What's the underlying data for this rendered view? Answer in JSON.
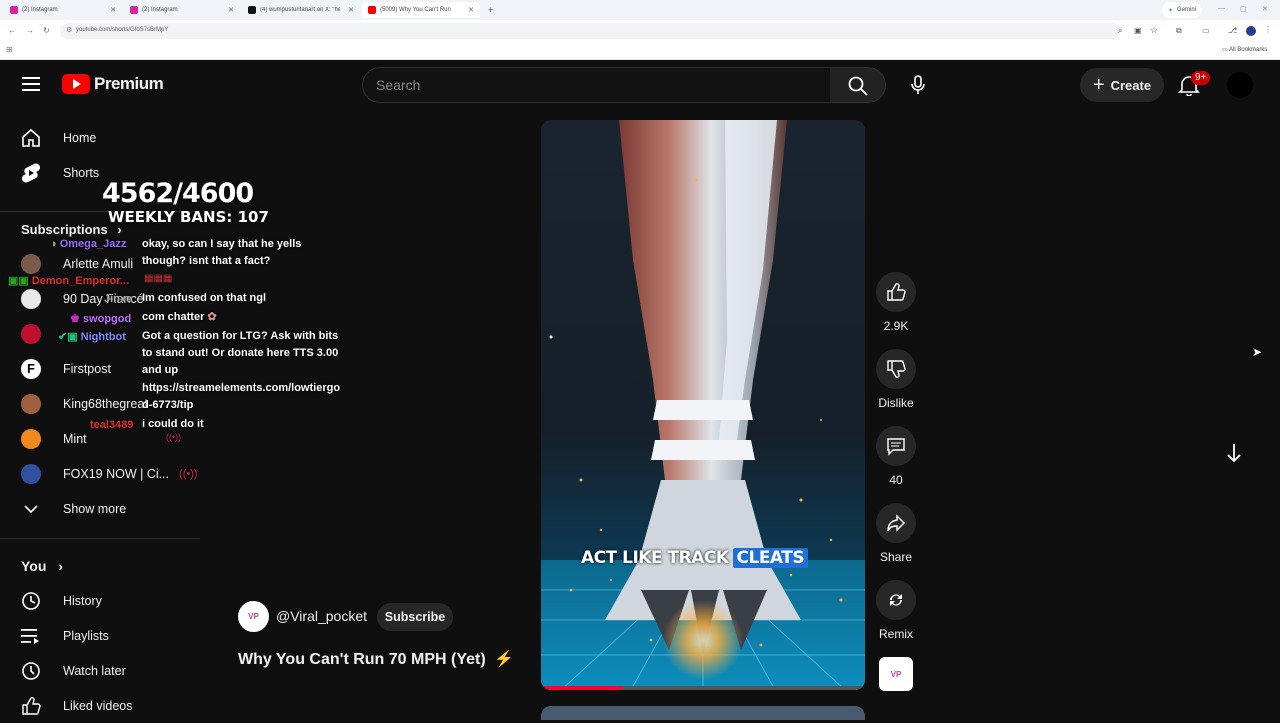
{
  "browser": {
    "tabs": [
      {
        "title": "(2) Instagram"
      },
      {
        "title": "(2) Instagram"
      },
      {
        "title": "(4) wumpusfunfanart on X: \"he..."
      },
      {
        "title": "(5009) Why You Can't Run"
      }
    ],
    "new_tab": "+",
    "gemini": "Gemini",
    "url": "youtube.com/shorts/GfoS7sBrMpY",
    "all_bookmarks": "All Bookmarks"
  },
  "header": {
    "logo_text": "Premium",
    "search_placeholder": "Search",
    "create_label": "Create",
    "notif_badge": "9+"
  },
  "sidebar": {
    "items": [
      {
        "label": "Home"
      },
      {
        "label": "Shorts"
      }
    ],
    "subscriptions_title": "Subscriptions",
    "subscriptions": [
      {
        "label": "Arlette Amuli",
        "color": "#7a5a4a"
      },
      {
        "label": "90 Day Fiancé",
        "color": "#e8e8e8"
      },
      {
        "label": "",
        "color": "#c01030"
      },
      {
        "label": "Firstpost",
        "color": "#ffffff"
      },
      {
        "label": "King68thegreat",
        "color": "#a06040"
      },
      {
        "label": "Mint",
        "color": "#f08a1c"
      },
      {
        "label": "FOX19 NOW | Ci...",
        "color": "#3050a0"
      }
    ],
    "show_more": "Show more",
    "you_title": "You",
    "you_items": [
      {
        "label": "History"
      },
      {
        "label": "Playlists"
      },
      {
        "label": "Watch later"
      },
      {
        "label": "Liked videos"
      }
    ]
  },
  "overlay": {
    "ban_count": "4562/4600",
    "weekly_bans": "WEEKLY BANS: 107",
    "users": [
      {
        "name": "Omega_Jazz",
        "color": "#9b6bff"
      },
      {
        "name": "Demon_Emperor...",
        "color": "#e0302a"
      },
      {
        "name": "Jinxe",
        "color": "#b0b0b0"
      },
      {
        "name": "swopgod",
        "color": "#c070ff"
      },
      {
        "name": "Nightbot",
        "color": "#7b8cff"
      },
      {
        "name": "teal3489",
        "color": "#e0302a"
      }
    ],
    "messages": [
      "okay, so can I say that he yells",
      "though? isnt that a fact?",
      "Im confused on that ngl",
      "com chatter",
      "Got a question for LTG? Ask with bits",
      "to stand out! Or donate here TTS 3.00",
      "and up",
      "https://streamelements.com/lowtiergo",
      "d-6773/tip",
      "i could do it"
    ]
  },
  "short": {
    "caption_part1": "ACT LIKE TRACK",
    "caption_part2": "CLEATS",
    "channel": "@Viral_pocket",
    "subscribe": "Subscribe",
    "title": "Why You Can't Run 70 MPH (Yet)",
    "progress": 0.25
  },
  "actions": {
    "likes": "2.9K",
    "dislike": "Dislike",
    "comments": "40",
    "share": "Share",
    "remix": "Remix"
  }
}
